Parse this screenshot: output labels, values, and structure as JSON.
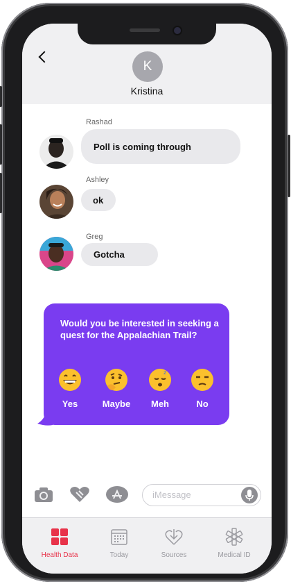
{
  "header": {
    "contact_initial": "K",
    "contact_name": "Kristina"
  },
  "messages": [
    {
      "sender": "Rashad",
      "text": "Poll is coming through"
    },
    {
      "sender": "Ashley",
      "text": "ok"
    },
    {
      "sender": "Greg",
      "text": "Gotcha"
    }
  ],
  "poll": {
    "question": "Would you be interested in seeking a quest for the Appalachian Trail?",
    "color": "#7a3cf0",
    "options": [
      {
        "label": "Yes",
        "icon": "grinning-face-emoji"
      },
      {
        "label": "Maybe",
        "icon": "thinking-face-emoji"
      },
      {
        "label": "Meh",
        "icon": "sleeping-face-emoji"
      },
      {
        "label": "No",
        "icon": "unamused-face-emoji"
      }
    ]
  },
  "input_bar": {
    "placeholder": "iMessage"
  },
  "tabbar": {
    "accent": "#e8334a",
    "tabs": [
      {
        "label": "Health Data",
        "icon": "grid-icon",
        "active": true
      },
      {
        "label": "Today",
        "icon": "calendar-icon",
        "active": false
      },
      {
        "label": "Sources",
        "icon": "download-heart-icon",
        "active": false
      },
      {
        "label": "Medical ID",
        "icon": "medical-star-icon",
        "active": false
      }
    ]
  }
}
